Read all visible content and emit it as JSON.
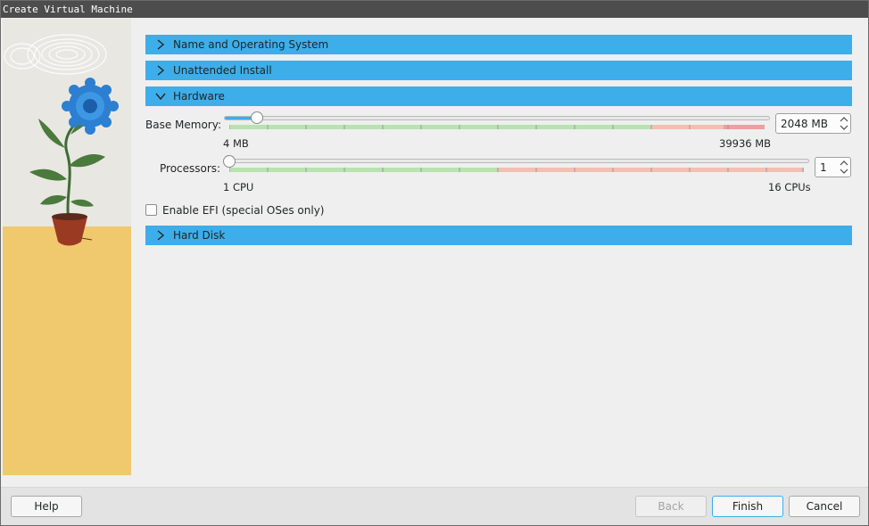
{
  "window": {
    "title": "Create Virtual Machine"
  },
  "sections": {
    "name_os": {
      "label": "Name and Operating System",
      "expanded": false
    },
    "unattended": {
      "label": "Unattended Install",
      "expanded": false
    },
    "hardware": {
      "label": "Hardware",
      "expanded": true
    },
    "hard_disk": {
      "label": "Hard Disk",
      "expanded": false
    }
  },
  "hardware": {
    "base_memory": {
      "label": "Base Memory:",
      "value": "2048 MB",
      "min_label": "4 MB",
      "max_label": "39936 MB",
      "min": 4,
      "max": 39936,
      "current": 2048
    },
    "processors": {
      "label": "Processors:",
      "value": "1",
      "min_label": "1 CPU",
      "max_label": "16 CPUs",
      "min": 1,
      "max": 16,
      "current": 1
    },
    "efi": {
      "label": "Enable EFI (special OSes only)",
      "checked": false
    }
  },
  "buttons": {
    "help": "Help",
    "back": "Back",
    "finish": "Finish",
    "cancel": "Cancel"
  },
  "colors": {
    "accent": "#3daee9",
    "recommended": "#b7e3b0",
    "warning": "#f2c0b0",
    "danger": "#ee9f9f"
  }
}
